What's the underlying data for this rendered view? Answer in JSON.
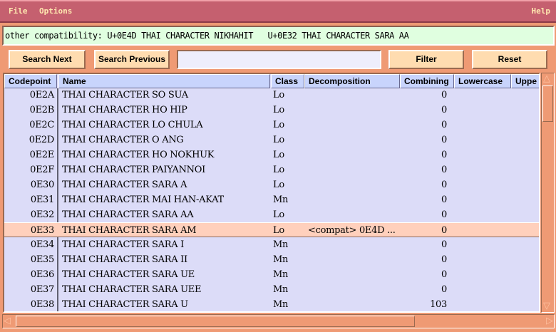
{
  "menubar": {
    "file": "File",
    "options": "Options",
    "help": "Help"
  },
  "info_text": "other compatibility: U+0E4D THAI CHARACTER NIKHAHIT   U+0E32 THAI CHARACTER SARA AA",
  "toolbar": {
    "search_next": "Search Next",
    "search_previous": "Search Previous",
    "search_value": "",
    "filter": "Filter",
    "reset": "Reset"
  },
  "table": {
    "columns": [
      "Codepoint",
      "Name",
      "Class",
      "Decomposition",
      "Combining",
      "Lowercase",
      "Uppe"
    ],
    "selected_index": 9,
    "rows": [
      [
        "0E2A",
        "THAI CHARACTER SO SUA",
        "Lo",
        "",
        "0"
      ],
      [
        "0E2B",
        "THAI CHARACTER HO HIP",
        "Lo",
        "",
        "0"
      ],
      [
        "0E2C",
        "THAI CHARACTER LO CHULA",
        "Lo",
        "",
        "0"
      ],
      [
        "0E2D",
        "THAI CHARACTER O ANG",
        "Lo",
        "",
        "0"
      ],
      [
        "0E2E",
        "THAI CHARACTER HO NOKHUK",
        "Lo",
        "",
        "0"
      ],
      [
        "0E2F",
        "THAI CHARACTER PAIYANNOI",
        "Lo",
        "",
        "0"
      ],
      [
        "0E30",
        "THAI CHARACTER SARA A",
        "Lo",
        "",
        "0"
      ],
      [
        "0E31",
        "THAI CHARACTER MAI HAN-AKAT",
        "Mn",
        "",
        "0"
      ],
      [
        "0E32",
        "THAI CHARACTER SARA AA",
        "Lo",
        "",
        "0"
      ],
      [
        "0E33",
        "THAI CHARACTER SARA AM",
        "Lo",
        "<compat> 0E4D ...",
        "0"
      ],
      [
        "0E34",
        "THAI CHARACTER SARA I",
        "Mn",
        "",
        "0"
      ],
      [
        "0E35",
        "THAI CHARACTER SARA II",
        "Mn",
        "",
        "0"
      ],
      [
        "0E36",
        "THAI CHARACTER SARA UE",
        "Mn",
        "",
        "0"
      ],
      [
        "0E37",
        "THAI CHARACTER SARA UEE",
        "Mn",
        "",
        "0"
      ],
      [
        "0E38",
        "THAI CHARACTER SARA U",
        "Mn",
        "",
        "103"
      ]
    ]
  },
  "colors": {
    "menubar": "#c5606f",
    "background": "#ef9a74",
    "info": "#e0ffe0",
    "button": "#ffdcb0",
    "table": "#dcdcf8",
    "header": "#c8d4fc",
    "selected": "#ffd0bc"
  }
}
